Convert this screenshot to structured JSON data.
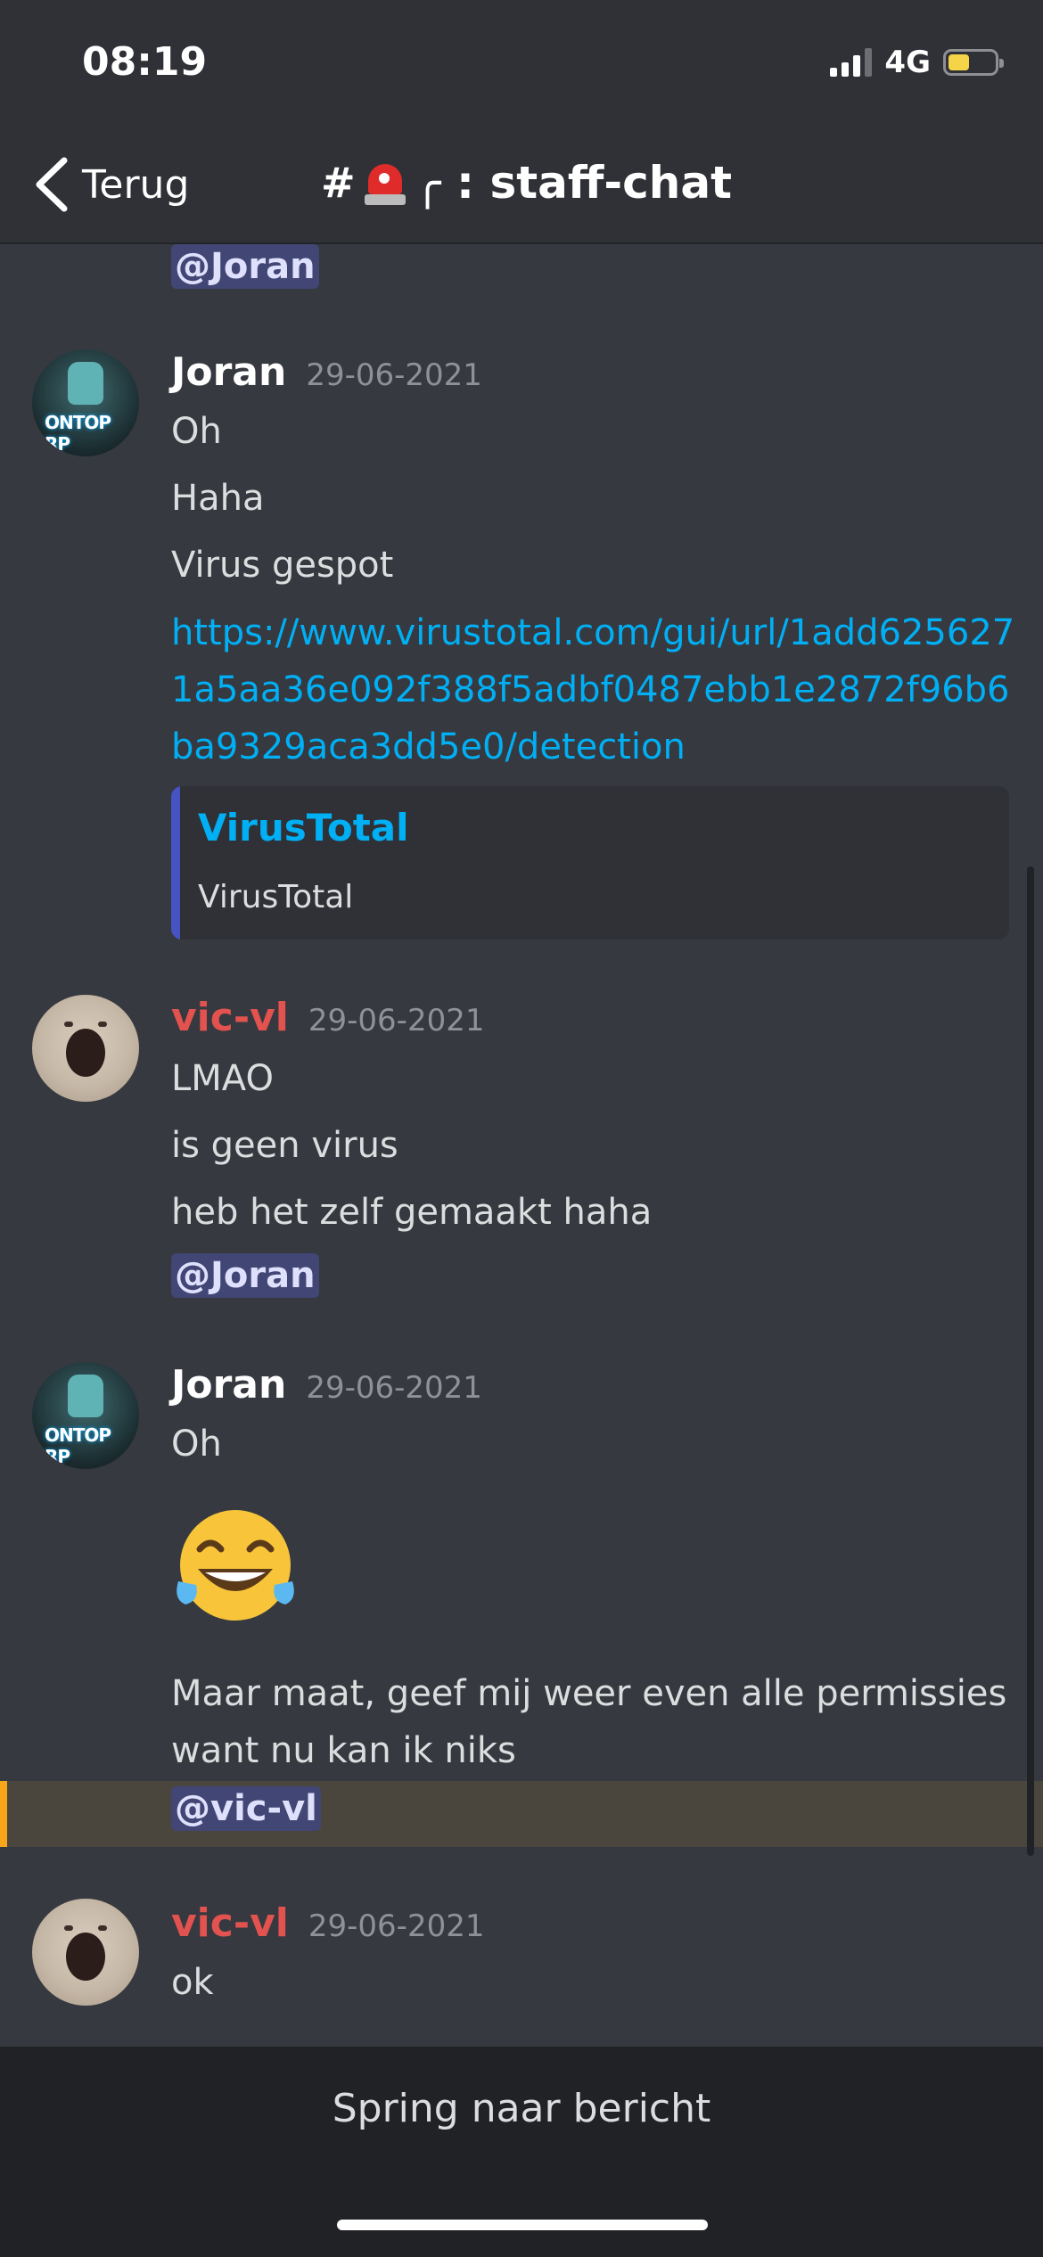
{
  "status_bar": {
    "time": "08:19",
    "network": "4G",
    "battery_percent": 45
  },
  "nav": {
    "back_label": "Terug",
    "channel_hash": "#",
    "channel_name": "╭ : staff-chat",
    "channel_icon": "siren-icon"
  },
  "colors": {
    "background": "#36393f",
    "mention_bg": "#414675",
    "link": "#00aff4",
    "vic_name": "#e2524f",
    "highlight_edge": "#faa61a"
  },
  "messages": [
    {
      "partial_mention": "@Joran"
    },
    {
      "author": "Joran",
      "date": "29-06-2021",
      "lines": [
        "Oh",
        "Haha",
        "Virus gespot"
      ],
      "link": "https://www.virustotal.com/gui/url/1add6256271a5aa36e092f388f5adbf0487ebb1e2872f96b6ba9329aca3dd5e0/detection",
      "embed": {
        "title": "VirusTotal",
        "description": "VirusTotal"
      }
    },
    {
      "author": "vic-vl",
      "date": "29-06-2021",
      "lines": [
        "LMAO",
        "is geen virus",
        "heb het zelf gemaakt haha"
      ],
      "mention": "@Joran"
    },
    {
      "author": "Joran",
      "date": "29-06-2021",
      "lines": [
        "Oh"
      ],
      "emoji": "😂",
      "text_block": "Maar maat, geef mij weer even alle permissies want nu kan ik niks",
      "mention": "@vic-vl"
    },
    {
      "author": "vic-vl",
      "date": "29-06-2021",
      "lines": [
        "ok"
      ]
    }
  ],
  "jump_button": {
    "label": "Spring naar bericht"
  }
}
